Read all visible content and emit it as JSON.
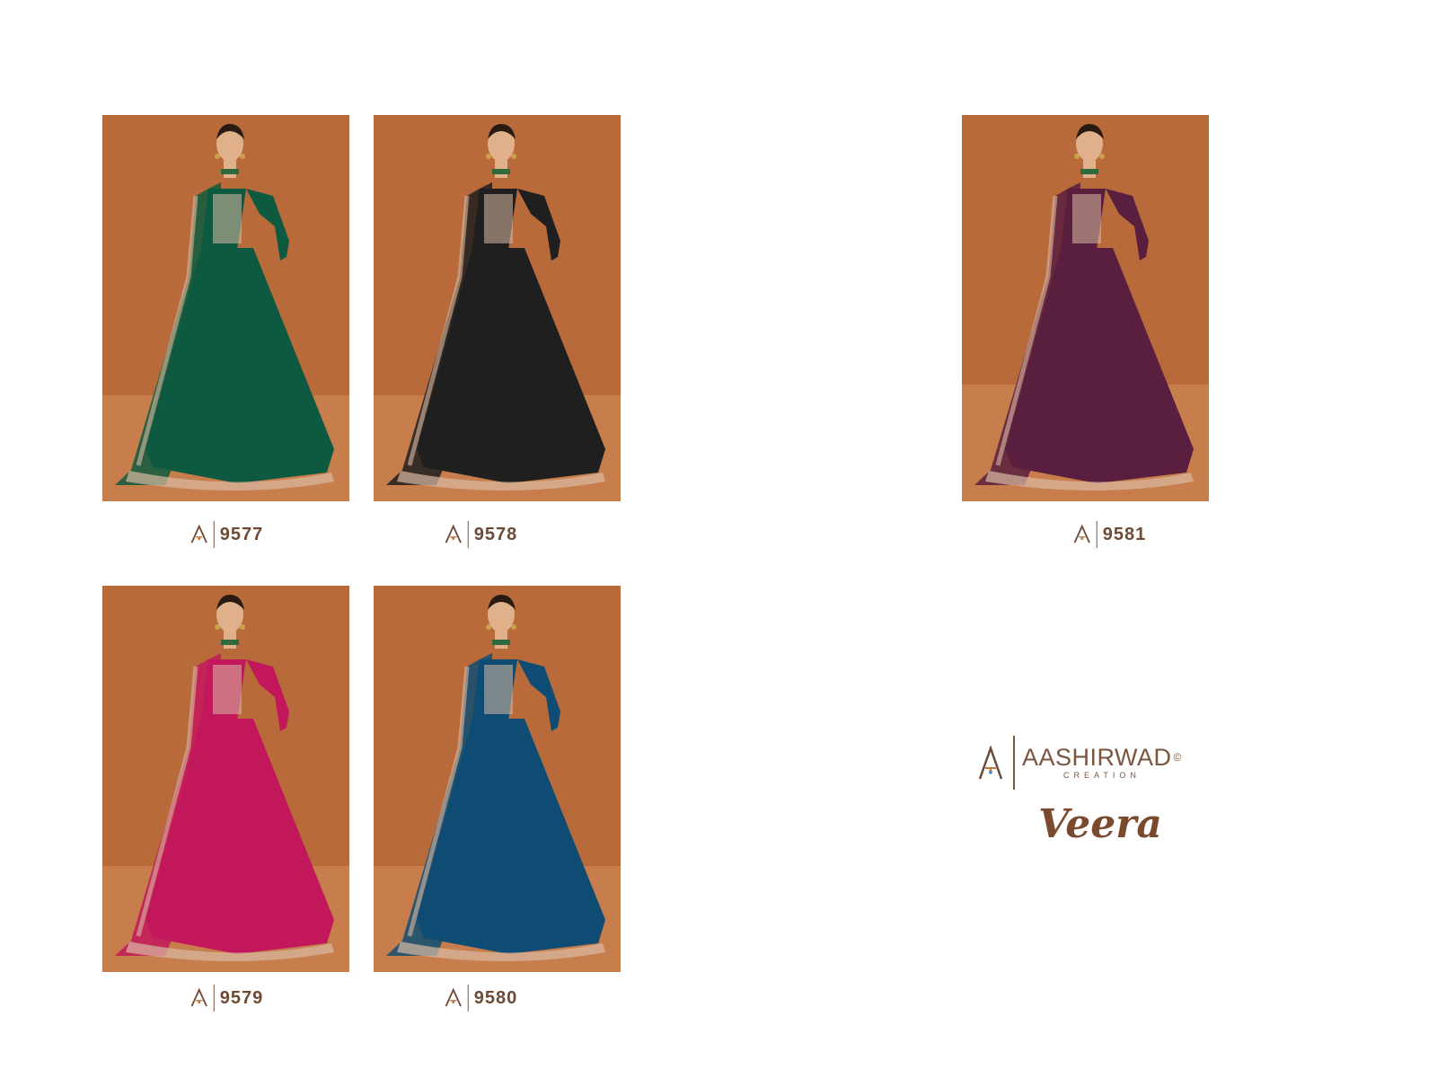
{
  "products": [
    {
      "code": "9577",
      "color": "#0e5a40"
    },
    {
      "code": "9578",
      "color": "#1f1f1f"
    },
    {
      "code": "9581",
      "color": "#5a1f3e"
    },
    {
      "code": "9579",
      "color": "#c2185b"
    },
    {
      "code": "9580",
      "color": "#0f4c73"
    }
  ],
  "brand": {
    "name": "AASHIRWAD",
    "registered": "©",
    "subtitle": "CREATION",
    "collection": "Veera"
  },
  "colors": {
    "backdrop": "#b86a3a",
    "floor": "#c77e4c",
    "brand_text": "#7a5540",
    "embroidery": "#d9b9a3"
  }
}
